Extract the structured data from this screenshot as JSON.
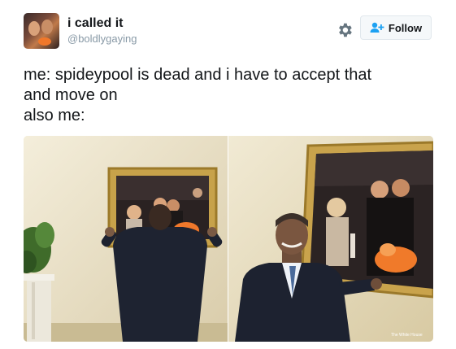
{
  "user": {
    "display_name": "i called it",
    "handle": "@boldlygaying"
  },
  "actions": {
    "settings_icon": "gear-icon",
    "follow_icon": "add-user-icon",
    "follow_label": "Follow"
  },
  "tweet": {
    "lines": [
      "me: spideypool is dead and i have to accept that",
      "and move on",
      "also me:"
    ]
  },
  "media": {
    "photos": [
      "photo-left",
      "photo-right"
    ],
    "watermark": "The White House"
  },
  "colors": {
    "text": "#14171a",
    "secondary_text": "#8899a6",
    "accent": "#1da1f2",
    "button_bg": "#f5f8fa",
    "border": "#e1e8ed"
  }
}
